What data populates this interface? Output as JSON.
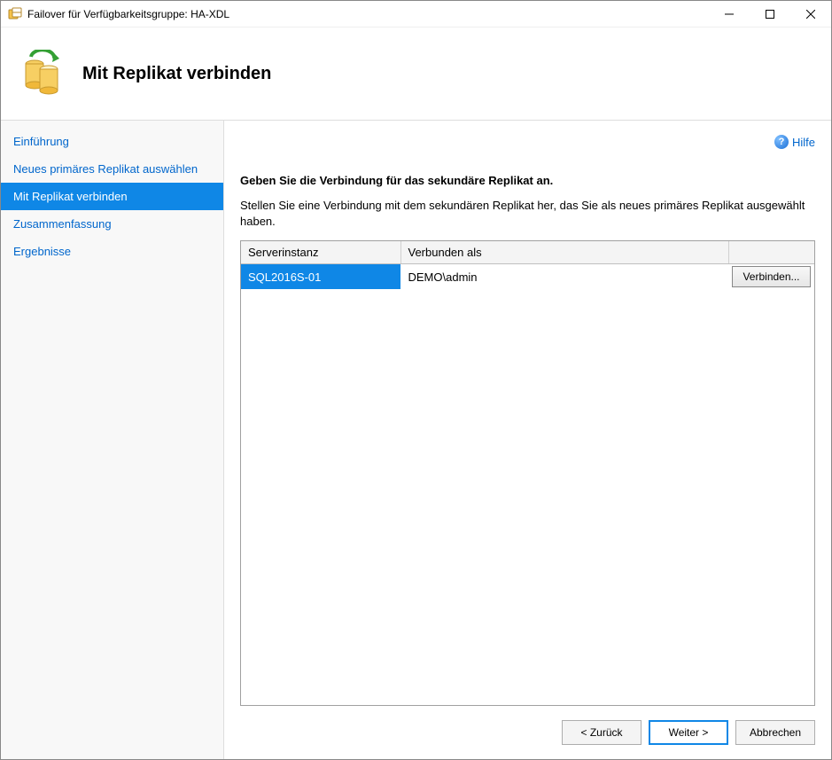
{
  "window": {
    "title": "Failover für Verfügbarkeitsgruppe: HA-XDL"
  },
  "header": {
    "title": "Mit Replikat verbinden"
  },
  "sidebar": {
    "items": [
      {
        "label": "Einführung",
        "active": false
      },
      {
        "label": "Neues primäres Replikat auswählen",
        "active": false
      },
      {
        "label": "Mit Replikat verbinden",
        "active": true
      },
      {
        "label": "Zusammenfassung",
        "active": false
      },
      {
        "label": "Ergebnisse",
        "active": false
      }
    ]
  },
  "help": {
    "label": "Hilfe"
  },
  "content": {
    "heading": "Geben Sie die Verbindung für das sekundäre Replikat an.",
    "description": "Stellen Sie eine Verbindung mit dem sekundären Replikat her, das Sie als neues primäres Replikat ausgewählt haben.",
    "table": {
      "columns": {
        "instance": "Serverinstanz",
        "connected_as": "Verbunden als",
        "action": ""
      },
      "rows": [
        {
          "instance": "SQL2016S-01",
          "connected_as": "DEMO\\admin",
          "connect_label": "Verbinden..."
        }
      ]
    }
  },
  "footer": {
    "back": "< Zurück",
    "next": "Weiter >",
    "cancel": "Abbrechen"
  }
}
